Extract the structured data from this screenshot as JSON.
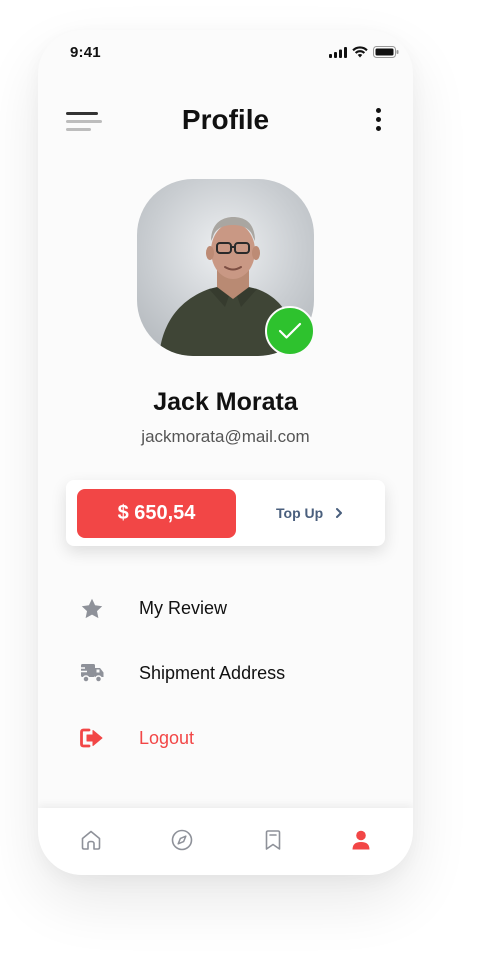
{
  "status_bar": {
    "time": "9:41",
    "icons": [
      "signal-icon",
      "wifi-icon",
      "battery-icon"
    ]
  },
  "header": {
    "title": "Profile",
    "left_icon": "menu-icon",
    "right_icon": "more-vertical-icon"
  },
  "profile": {
    "name": "Jack Morata",
    "email": "jackmorata@mail.com",
    "verified_icon": "check-icon"
  },
  "balance": {
    "amount": "$ 650,54",
    "topup_label": "Top Up",
    "topup_icon": "chevron-right-icon"
  },
  "menu": [
    {
      "label": "My Review",
      "icon": "star-icon"
    },
    {
      "label": "Shipment Address",
      "icon": "truck-icon"
    },
    {
      "label": "Logout",
      "icon": "logout-icon"
    }
  ],
  "bottom_nav": [
    {
      "icon": "home-icon",
      "active": false
    },
    {
      "icon": "compass-icon",
      "active": false
    },
    {
      "icon": "bookmark-icon",
      "active": false
    },
    {
      "icon": "user-icon",
      "active": true
    }
  ],
  "colors": {
    "accent": "#f24646",
    "verified": "#2ec22e",
    "topup_text": "#4a5f7d",
    "inactive_icon": "#8e9199",
    "background": "#fbfbfb"
  }
}
